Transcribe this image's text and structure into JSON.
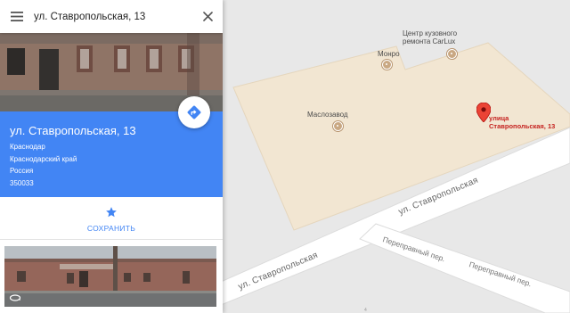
{
  "search": {
    "value": "ул. Ставропольская, 13"
  },
  "place": {
    "title": "ул. Ставропольская, 13",
    "address_lines": [
      "Краснодар",
      "Краснодарский край",
      "Россия",
      "350033"
    ],
    "save_label": "СОХРАНИТЬ"
  },
  "map": {
    "pois": [
      {
        "name": "Монро"
      },
      {
        "name": "Маслозавод"
      },
      {
        "name_lines": [
          "Центр кузовного",
          "ремонта CarLux"
        ]
      }
    ],
    "pin": {
      "label_lines": [
        "улица",
        "Ставропольская, 13"
      ]
    },
    "streets": [
      "ул. Ставропольская",
      "ул. Ставропольская"
    ],
    "lanes": [
      "Переправный пер.",
      "Переправный пер."
    ],
    "colors": {
      "building": "#f2e6d2",
      "road": "#ffffff",
      "background": "#e8e8e8",
      "pin": "#ea4335"
    }
  },
  "colors": {
    "accent": "#4285f4"
  },
  "icons": {
    "menu": "menu-icon",
    "close": "close-icon",
    "directions": "directions-icon",
    "save": "star-icon",
    "streetview": "rotate-360-icon"
  }
}
